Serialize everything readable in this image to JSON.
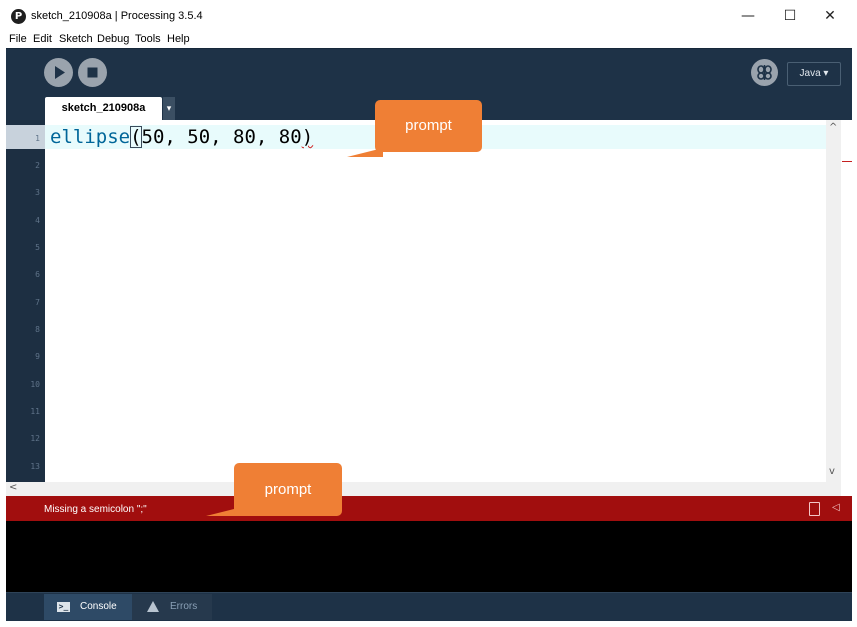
{
  "window": {
    "title": "sketch_210908a | Processing 3.5.4",
    "logo_text": "P",
    "controls": {
      "minimize": "—",
      "maximize": "☐",
      "close": "✕"
    }
  },
  "menu": [
    "File",
    "Edit",
    "Sketch",
    "Debug",
    "Tools",
    "Help"
  ],
  "toolbar": {
    "run_icon": "play-icon",
    "stop_icon": "stop-icon",
    "debug_icon": "butterfly-icon",
    "mode": "Java ▾"
  },
  "tabs": {
    "active": "sketch_210908a",
    "menu_arrow": "▾"
  },
  "editor": {
    "line_numbers": [
      "1",
      "2",
      "3",
      "4",
      "5",
      "6",
      "7",
      "8",
      "9",
      "10",
      "11",
      "12",
      "13"
    ],
    "code": {
      "keyword": "ellipse",
      "open_paren": "(",
      "args": "50, 50, 80, 80",
      "close_paren": ")"
    }
  },
  "scroll": {
    "up": "^",
    "down": "v",
    "left": "<"
  },
  "status": {
    "message": "Missing a semicolon \";\"",
    "clipboard_icon": "clipboard-icon",
    "collapse_icon": "◁"
  },
  "footer": {
    "console_label": "Console",
    "errors_label": "Errors",
    "console_icon_glyph": ">_"
  },
  "callouts": [
    "prompt",
    "prompt"
  ],
  "colors": {
    "toolbar_bg": "#1e3247",
    "status_error_bg": "#a10e0e",
    "callout": "#ef7f35",
    "keyword": "#006699",
    "active_line": "#e8fbfc"
  }
}
